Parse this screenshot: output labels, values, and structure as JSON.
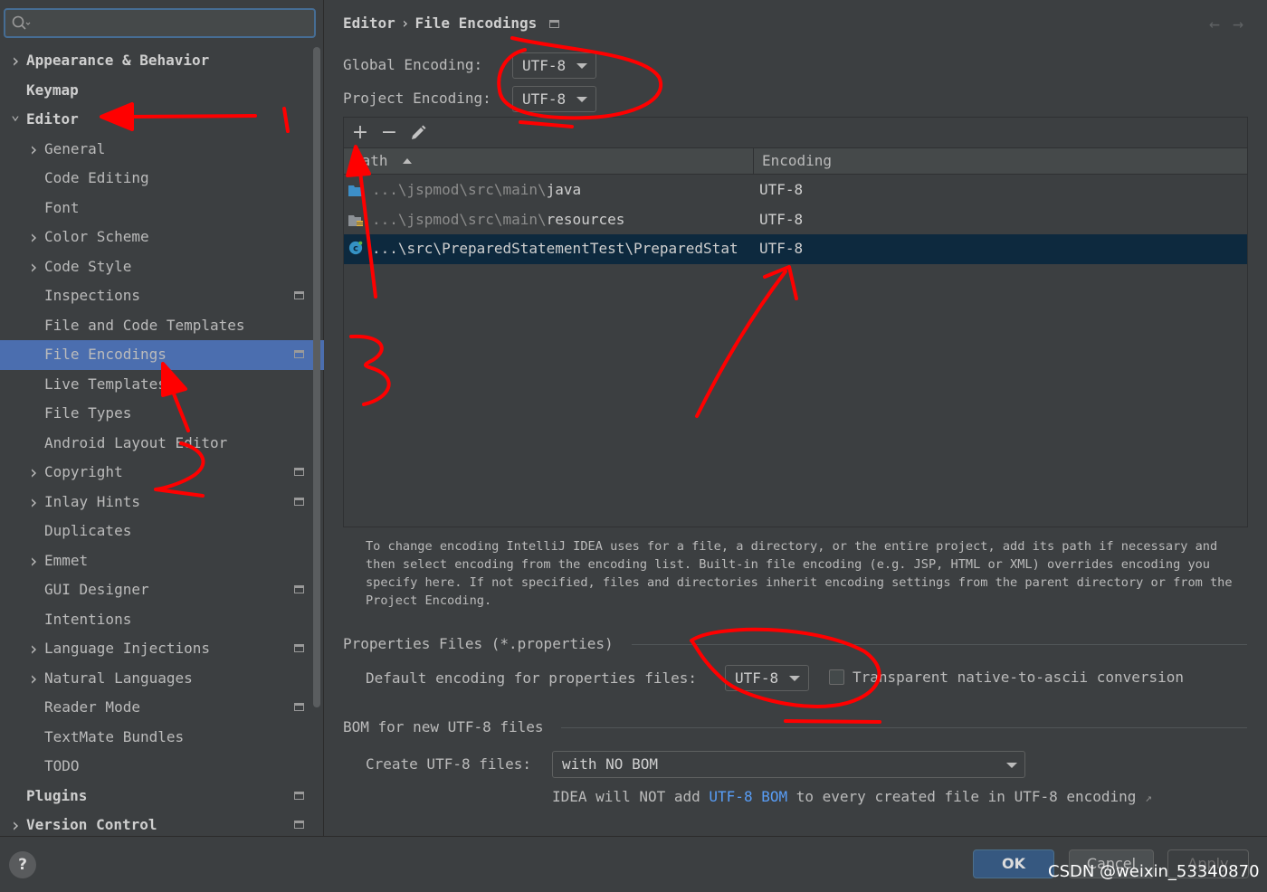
{
  "sidebar": {
    "search": {
      "placeholder": "",
      "value": ""
    },
    "items": [
      {
        "label": "Appearance & Behavior",
        "level": 0,
        "expandable": true,
        "expanded": false,
        "bold": true,
        "badge": false,
        "selected": false
      },
      {
        "label": "Keymap",
        "level": 0,
        "expandable": false,
        "bold": true,
        "badge": false,
        "selected": false
      },
      {
        "label": "Editor",
        "level": 0,
        "expandable": true,
        "expanded": true,
        "bold": true,
        "badge": false,
        "selected": false
      },
      {
        "label": "General",
        "level": 1,
        "expandable": true,
        "expanded": false,
        "bold": false,
        "badge": false,
        "selected": false
      },
      {
        "label": "Code Editing",
        "level": 1,
        "expandable": false,
        "bold": false,
        "badge": false,
        "selected": false
      },
      {
        "label": "Font",
        "level": 1,
        "expandable": false,
        "bold": false,
        "badge": false,
        "selected": false
      },
      {
        "label": "Color Scheme",
        "level": 1,
        "expandable": true,
        "expanded": false,
        "bold": false,
        "badge": false,
        "selected": false
      },
      {
        "label": "Code Style",
        "level": 1,
        "expandable": true,
        "expanded": false,
        "bold": false,
        "badge": false,
        "selected": false
      },
      {
        "label": "Inspections",
        "level": 1,
        "expandable": false,
        "bold": false,
        "badge": true,
        "selected": false
      },
      {
        "label": "File and Code Templates",
        "level": 1,
        "expandable": false,
        "bold": false,
        "badge": false,
        "selected": false
      },
      {
        "label": "File Encodings",
        "level": 1,
        "expandable": false,
        "bold": false,
        "badge": true,
        "selected": true
      },
      {
        "label": "Live Templates",
        "level": 1,
        "expandable": false,
        "bold": false,
        "badge": false,
        "selected": false
      },
      {
        "label": "File Types",
        "level": 1,
        "expandable": false,
        "bold": false,
        "badge": false,
        "selected": false
      },
      {
        "label": "Android Layout Editor",
        "level": 1,
        "expandable": false,
        "bold": false,
        "badge": false,
        "selected": false
      },
      {
        "label": "Copyright",
        "level": 1,
        "expandable": true,
        "expanded": false,
        "bold": false,
        "badge": true,
        "selected": false
      },
      {
        "label": "Inlay Hints",
        "level": 1,
        "expandable": true,
        "expanded": false,
        "bold": false,
        "badge": true,
        "selected": false
      },
      {
        "label": "Duplicates",
        "level": 1,
        "expandable": false,
        "bold": false,
        "badge": false,
        "selected": false
      },
      {
        "label": "Emmet",
        "level": 1,
        "expandable": true,
        "expanded": false,
        "bold": false,
        "badge": false,
        "selected": false
      },
      {
        "label": "GUI Designer",
        "level": 1,
        "expandable": false,
        "bold": false,
        "badge": true,
        "selected": false
      },
      {
        "label": "Intentions",
        "level": 1,
        "expandable": false,
        "bold": false,
        "badge": false,
        "selected": false
      },
      {
        "label": "Language Injections",
        "level": 1,
        "expandable": true,
        "expanded": false,
        "bold": false,
        "badge": true,
        "selected": false
      },
      {
        "label": "Natural Languages",
        "level": 1,
        "expandable": true,
        "expanded": false,
        "bold": false,
        "badge": false,
        "selected": false
      },
      {
        "label": "Reader Mode",
        "level": 1,
        "expandable": false,
        "bold": false,
        "badge": true,
        "selected": false
      },
      {
        "label": "TextMate Bundles",
        "level": 1,
        "expandable": false,
        "bold": false,
        "badge": false,
        "selected": false
      },
      {
        "label": "TODO",
        "level": 1,
        "expandable": false,
        "bold": false,
        "badge": false,
        "selected": false
      },
      {
        "label": "Plugins",
        "level": 0,
        "expandable": false,
        "bold": true,
        "badge": true,
        "selected": false
      },
      {
        "label": "Version Control",
        "level": 0,
        "expandable": true,
        "expanded": false,
        "bold": true,
        "badge": true,
        "selected": false
      }
    ]
  },
  "breadcrumb": {
    "parent": "Editor",
    "separator": "›",
    "current": "File Encodings"
  },
  "nav": {
    "back_icon": "arrow-left-icon",
    "forward_icon": "arrow-right-icon"
  },
  "global_encoding": {
    "label": "Global Encoding:",
    "value": "UTF-8"
  },
  "project_encoding": {
    "label": "Project Encoding:",
    "value": "UTF-8"
  },
  "table": {
    "toolbar": {
      "add": "+",
      "remove": "−",
      "edit_icon": "pencil-icon"
    },
    "columns": {
      "path": "Path",
      "encoding": "Encoding",
      "sort_icon": "sort-ascending-icon"
    },
    "rows": [
      {
        "icon": "folder-icon",
        "path_prefix": "...\\jspmod\\src\\main\\",
        "path_name": "java",
        "encoding": "UTF-8",
        "selected": false
      },
      {
        "icon": "resources-folder-icon",
        "path_prefix": "...\\jspmod\\src\\main\\",
        "path_name": "resources",
        "encoding": "UTF-8",
        "selected": false
      },
      {
        "icon": "java-class-icon",
        "path_prefix": "",
        "path_name": "...\\src\\PreparedStatementTest\\PreparedStat",
        "encoding": "UTF-8",
        "selected": true
      }
    ]
  },
  "help_text": "To change encoding IntelliJ IDEA uses for a file, a directory, or the entire project, add its path if necessary and then select encoding from the encoding list. Built-in file encoding (e.g. JSP, HTML or XML) overrides encoding you specify here. If not specified, files and directories inherit encoding settings from the parent directory or from the Project Encoding.",
  "properties": {
    "title": "Properties Files (*.properties)",
    "default_label": "Default encoding for properties files:",
    "default_value": "UTF-8",
    "transparent_label": "Transparent native-to-ascii conversion",
    "transparent_checked": false
  },
  "bom": {
    "title": "BOM for new UTF-8 files",
    "create_label": "Create UTF-8 files:",
    "create_value": "with NO BOM",
    "note_prefix": "IDEA will NOT add",
    "note_link": "UTF-8 BOM",
    "note_suffix": "to every created file in UTF-8 encoding",
    "note_icon": "external-link-icon"
  },
  "buttons": {
    "help": "?",
    "ok": "OK",
    "cancel": "Cancel",
    "apply": "Apply"
  },
  "watermark": "CSDN @weixin_53340870",
  "annotations": {
    "marker_1": "1",
    "marker_2": "2",
    "marker_3": "3",
    "color": "#ff0000"
  },
  "colors": {
    "background": "#3c3f41",
    "selection": "#4b6eaf",
    "table_selection": "#0d293e",
    "link": "#589df6",
    "ok_button": "#365880"
  }
}
